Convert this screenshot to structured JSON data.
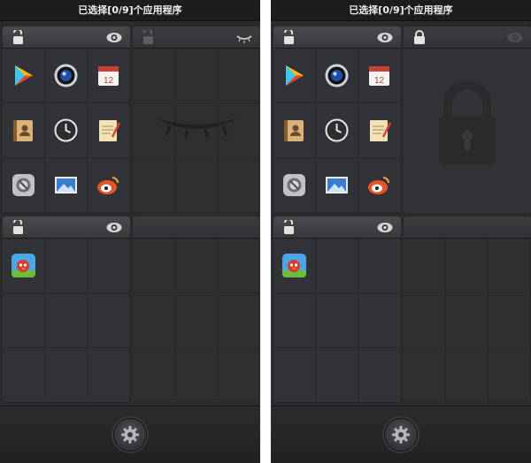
{
  "screens": [
    {
      "id": "left",
      "status_title": "已选择[0/9]个应用程序",
      "top_right_panel": "eye-closed"
    },
    {
      "id": "right",
      "status_title": "已选择[0/9]个应用程序",
      "top_right_panel": "locked"
    }
  ],
  "panels": {
    "top_left": {
      "apps": [
        "play-store-icon",
        "camera-icon",
        "calendar-icon",
        "contacts-icon",
        "clock-icon",
        "notes-icon",
        "settings-app-icon",
        "gallery-icon",
        "weibo-icon"
      ]
    },
    "bottom_left": {
      "apps": [
        "angry-birds-icon"
      ]
    }
  },
  "calendar_day": "12",
  "icons": {
    "header_left": "unlock-icon",
    "header_right": "eye-icon",
    "bottom_button": "gear-icon"
  },
  "colors": {
    "background": "#2a2b2d",
    "status_bar": "#1c1d1f",
    "panel_header": "#444548",
    "cell": "#323336"
  }
}
